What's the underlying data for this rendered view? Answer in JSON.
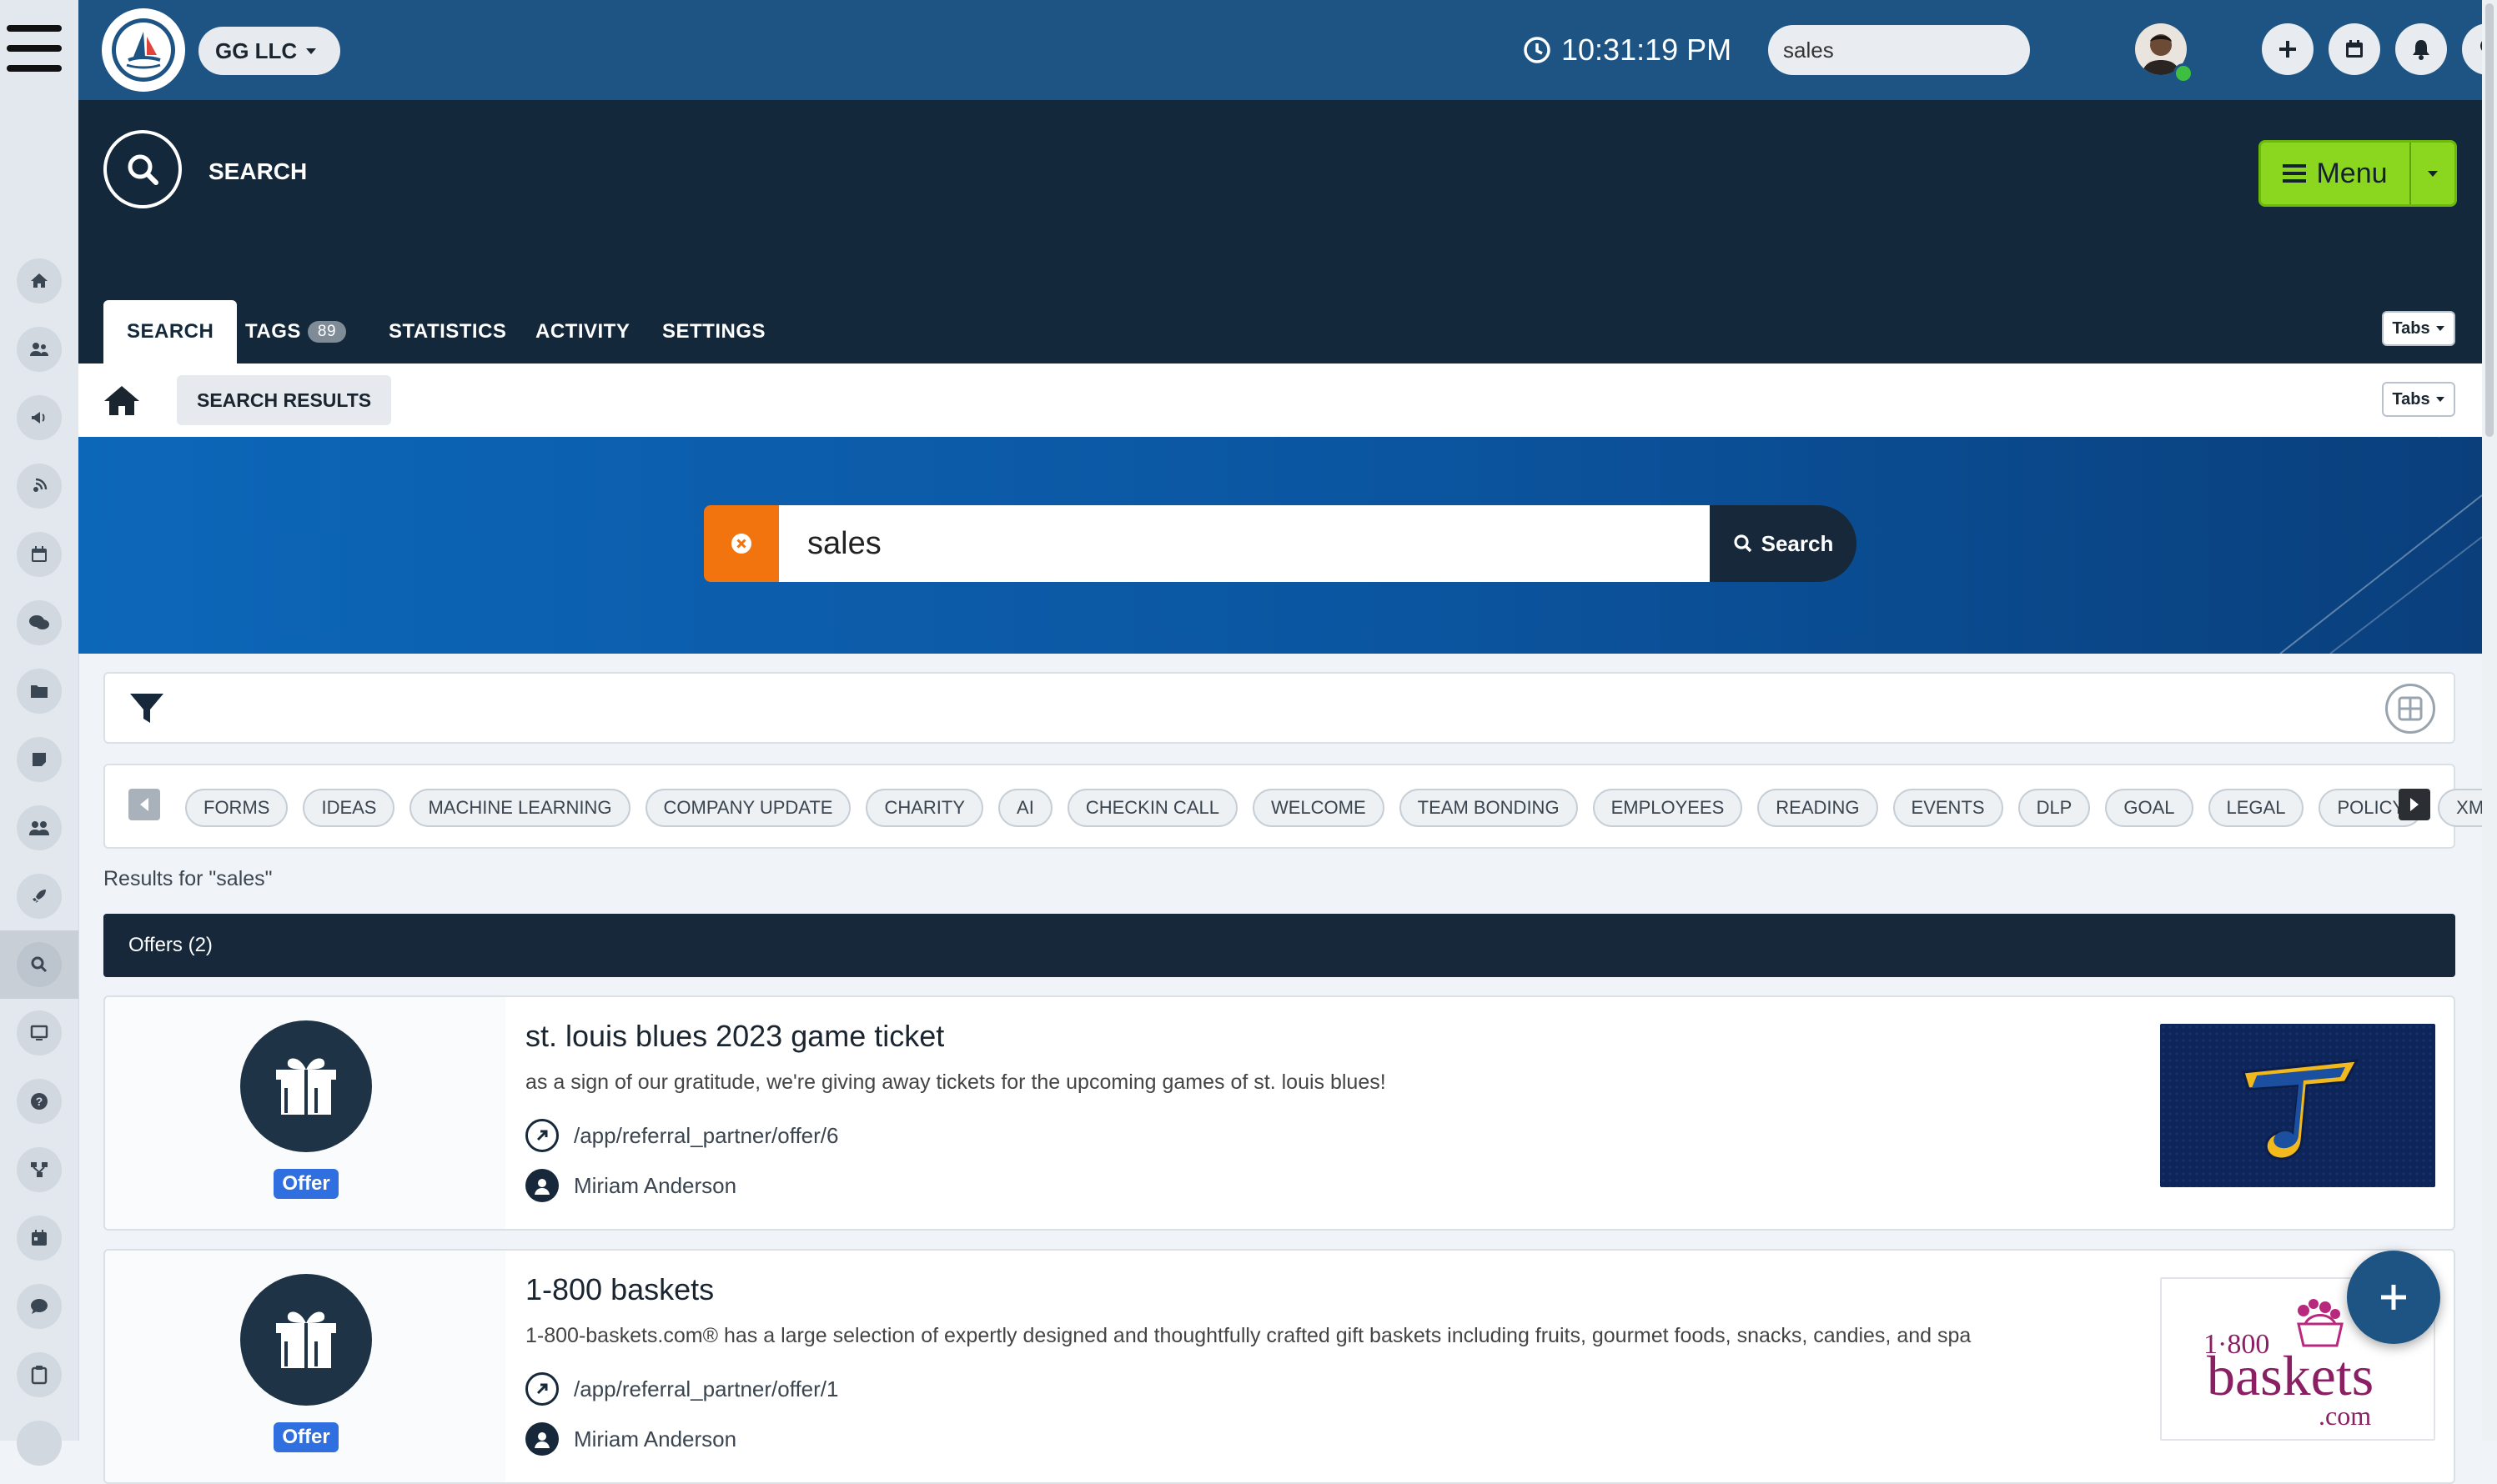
{
  "topbar": {
    "company": "GG LLC",
    "time": "10:31:19 PM",
    "search_value": "sales"
  },
  "header": {
    "title": "SEARCH",
    "menu_label": "Menu"
  },
  "tabs": {
    "items": [
      {
        "label": "SEARCH",
        "active": true
      },
      {
        "label": "TAGS",
        "badge": "89"
      },
      {
        "label": "STATISTICS"
      },
      {
        "label": "ACTIVITY"
      },
      {
        "label": "SETTINGS"
      }
    ],
    "dropdown_label": "Tabs"
  },
  "breadcrumb": {
    "current": "SEARCH RESULTS",
    "dropdown_label": "Tabs"
  },
  "hero": {
    "query": "sales",
    "button_label": "Search"
  },
  "tags": [
    "FORMS",
    "IDEAS",
    "MACHINE LEARNING",
    "COMPANY UPDATE",
    "CHARITY",
    "AI",
    "CHECKIN CALL",
    "WELCOME",
    "TEAM BONDING",
    "EMPLOYEES",
    "READING",
    "EVENTS",
    "DLP",
    "GOAL",
    "LEGAL",
    "POLICY",
    "XMAS"
  ],
  "results": {
    "label": "Results for \"sales\"",
    "section_title": "Offers (2)",
    "items": [
      {
        "title": "st. louis blues 2023 game ticket",
        "description": "as a sign of our gratitude, we're giving away tickets for the upcoming games of st. louis blues!",
        "link": "/app/referral_partner/offer/6",
        "author": "Miriam Anderson",
        "badge": "Offer"
      },
      {
        "title": "1-800 baskets",
        "description": "1-800-baskets.com® has a large selection of expertly designed and thoughtfully crafted gift baskets including fruits, gourmet foods, snacks, candies, and spa",
        "link": "/app/referral_partner/offer/1",
        "author": "Miriam Anderson",
        "badge": "Offer",
        "logo_top": "1·800",
        "logo_main": "baskets",
        "logo_suffix": ".com"
      }
    ]
  },
  "colors": {
    "topbar": "#1d5484",
    "header": "#13283a",
    "accent_green": "#8bd61e",
    "clear_orange": "#f2740f",
    "offer_badge": "#2f6fdf"
  },
  "icons": {
    "sidebar": [
      "home-icon",
      "users-icon",
      "megaphone-icon",
      "satellite-icon",
      "calendar-icon",
      "chat-icon",
      "folder-icon",
      "note-icon",
      "team-icon",
      "rocket-icon",
      "search-icon",
      "monitor-icon",
      "help-icon",
      "network-icon",
      "calendar-alt-icon",
      "comment-icon",
      "clipboard-icon",
      "more-icon"
    ]
  }
}
